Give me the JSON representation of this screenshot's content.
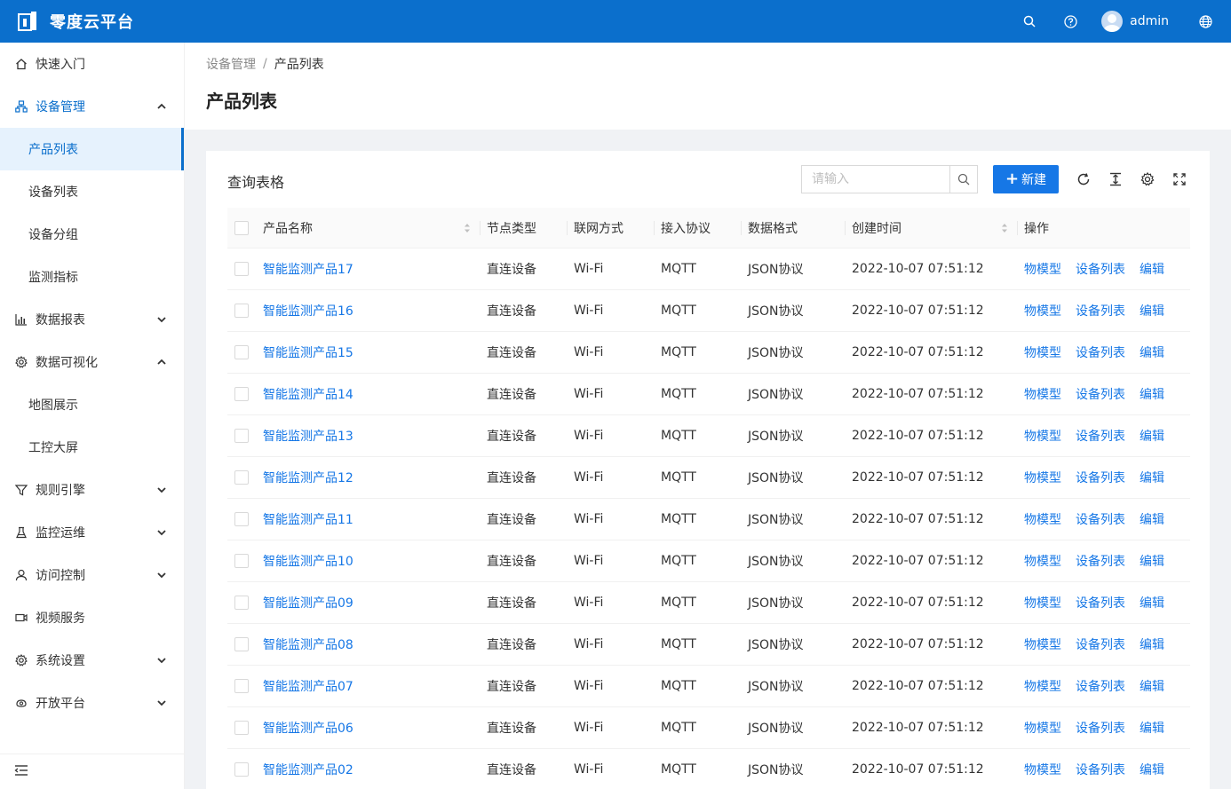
{
  "header": {
    "title": "零度云平台",
    "user_name": "admin"
  },
  "sidebar": {
    "menu": [
      {
        "label": "快速入门",
        "icon": "home-icon"
      },
      {
        "label": "设备管理",
        "icon": "cluster-icon",
        "expanded": true,
        "children": [
          {
            "label": "产品列表",
            "selected": true
          },
          {
            "label": "设备列表"
          },
          {
            "label": "设备分组"
          },
          {
            "label": "监测指标"
          }
        ]
      },
      {
        "label": "数据报表",
        "icon": "bar-chart-icon",
        "expanded": false
      },
      {
        "label": "数据可视化",
        "icon": "settings-icon",
        "expanded": true,
        "children": [
          {
            "label": "地图展示"
          },
          {
            "label": "工控大屏"
          }
        ]
      },
      {
        "label": "规则引擎",
        "icon": "funnel-icon",
        "expanded": false
      },
      {
        "label": "监控运维",
        "icon": "flask-icon",
        "expanded": false
      },
      {
        "label": "访问控制",
        "icon": "user-icon",
        "expanded": false
      },
      {
        "label": "视频服务",
        "icon": "video-camera-icon"
      },
      {
        "label": "系统设置",
        "icon": "settings-icon",
        "expanded": false
      },
      {
        "label": "开放平台",
        "icon": "api-icon",
        "expanded": false
      }
    ]
  },
  "breadcrumb": {
    "parent": "设备管理",
    "separator": "/",
    "current": "产品列表"
  },
  "page_title": "产品列表",
  "card": {
    "title": "查询表格",
    "search_placeholder": "请输入",
    "new_button": "新建"
  },
  "table": {
    "columns": [
      "产品名称",
      "节点类型",
      "联网方式",
      "接入协议",
      "数据格式",
      "创建时间",
      "操作"
    ],
    "actions": [
      "物模型",
      "设备列表",
      "编辑"
    ],
    "rows": [
      {
        "name": "智能监测产品17",
        "node": "直连设备",
        "net": "Wi-Fi",
        "protocol": "MQTT",
        "format": "JSON协议",
        "created": "2022-10-07 07:51:12"
      },
      {
        "name": "智能监测产品16",
        "node": "直连设备",
        "net": "Wi-Fi",
        "protocol": "MQTT",
        "format": "JSON协议",
        "created": "2022-10-07 07:51:12"
      },
      {
        "name": "智能监测产品15",
        "node": "直连设备",
        "net": "Wi-Fi",
        "protocol": "MQTT",
        "format": "JSON协议",
        "created": "2022-10-07 07:51:12"
      },
      {
        "name": "智能监测产品14",
        "node": "直连设备",
        "net": "Wi-Fi",
        "protocol": "MQTT",
        "format": "JSON协议",
        "created": "2022-10-07 07:51:12"
      },
      {
        "name": "智能监测产品13",
        "node": "直连设备",
        "net": "Wi-Fi",
        "protocol": "MQTT",
        "format": "JSON协议",
        "created": "2022-10-07 07:51:12"
      },
      {
        "name": "智能监测产品12",
        "node": "直连设备",
        "net": "Wi-Fi",
        "protocol": "MQTT",
        "format": "JSON协议",
        "created": "2022-10-07 07:51:12"
      },
      {
        "name": "智能监测产品11",
        "node": "直连设备",
        "net": "Wi-Fi",
        "protocol": "MQTT",
        "format": "JSON协议",
        "created": "2022-10-07 07:51:12"
      },
      {
        "name": "智能监测产品10",
        "node": "直连设备",
        "net": "Wi-Fi",
        "protocol": "MQTT",
        "format": "JSON协议",
        "created": "2022-10-07 07:51:12"
      },
      {
        "name": "智能监测产品09",
        "node": "直连设备",
        "net": "Wi-Fi",
        "protocol": "MQTT",
        "format": "JSON协议",
        "created": "2022-10-07 07:51:12"
      },
      {
        "name": "智能监测产品08",
        "node": "直连设备",
        "net": "Wi-Fi",
        "protocol": "MQTT",
        "format": "JSON协议",
        "created": "2022-10-07 07:51:12"
      },
      {
        "name": "智能监测产品07",
        "node": "直连设备",
        "net": "Wi-Fi",
        "protocol": "MQTT",
        "format": "JSON协议",
        "created": "2022-10-07 07:51:12"
      },
      {
        "name": "智能监测产品06",
        "node": "直连设备",
        "net": "Wi-Fi",
        "protocol": "MQTT",
        "format": "JSON协议",
        "created": "2022-10-07 07:51:12"
      },
      {
        "name": "智能监测产品02",
        "node": "直连设备",
        "net": "Wi-Fi",
        "protocol": "MQTT",
        "format": "JSON协议",
        "created": "2022-10-07 07:51:12"
      }
    ]
  },
  "colors": {
    "primary": "#0b6fcc",
    "link": "#1677e6",
    "selected_bg": "#e6f2fd"
  }
}
